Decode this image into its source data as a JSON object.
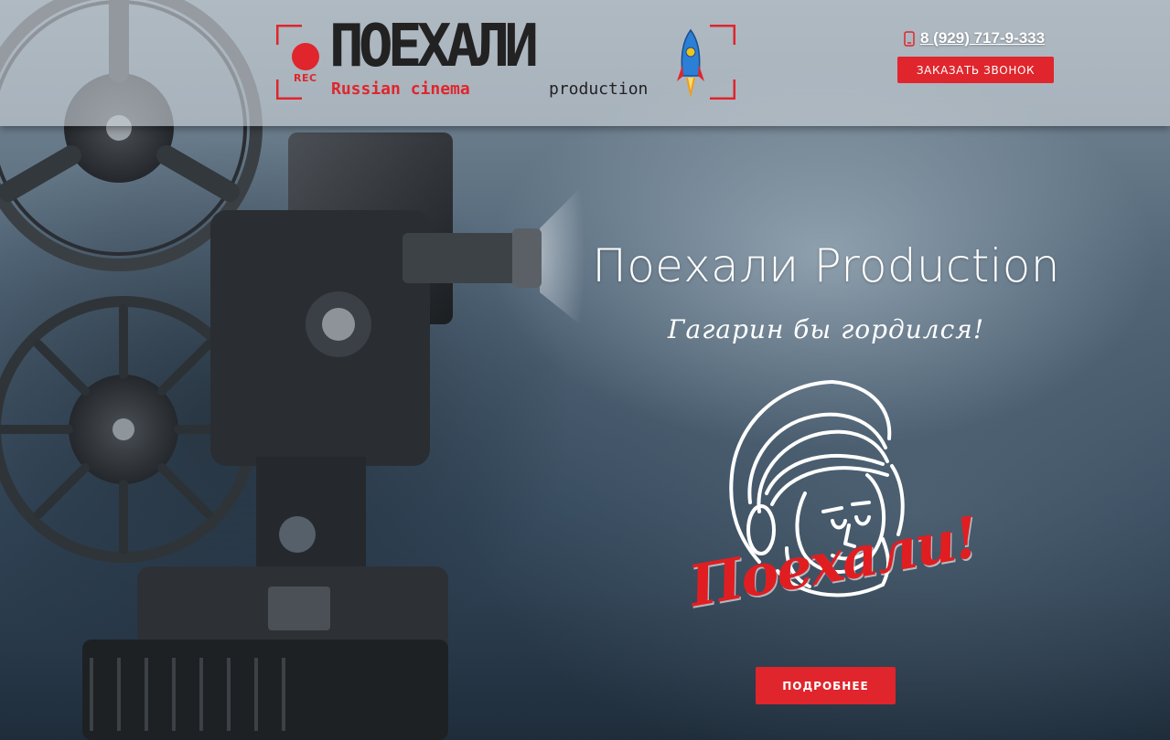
{
  "header": {
    "logo": {
      "rec": "REC",
      "title": "ПОЕХАЛИ",
      "subtitle_left": "Russian cinema",
      "subtitle_right": "production"
    },
    "phone": "8 (929) 717-9-333",
    "call_button": "ЗАКАЗАТЬ ЗВОНОК"
  },
  "hero": {
    "title": "Поехали Production",
    "subtitle": "Гагарин бы гордился!",
    "emblem_text": "Поехали!",
    "more_button": "ПОДРОБНЕЕ"
  },
  "colors": {
    "accent": "#e0252c",
    "header_band": "#cdd4da",
    "text_light": "#ffffff"
  },
  "icons": [
    "phone-icon",
    "rocket-icon",
    "rec-dot-icon"
  ]
}
